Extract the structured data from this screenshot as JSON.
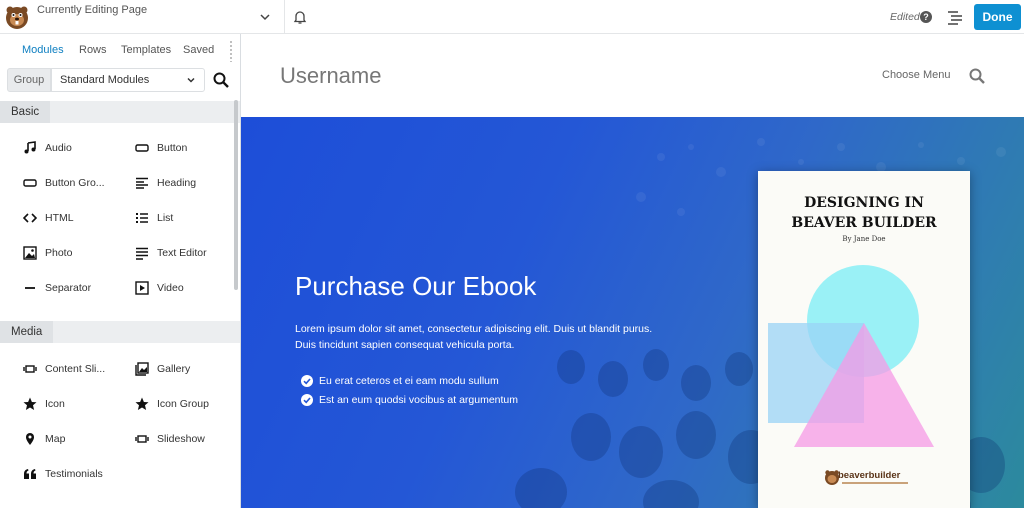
{
  "topbar": {
    "context_label": "Currently Editing Page",
    "status": "Edited",
    "help": "?",
    "done_label": "Done"
  },
  "sidebar": {
    "tabs": [
      "Modules",
      "Rows",
      "Templates",
      "Saved"
    ],
    "active_tab": "Modules",
    "group_button": "Group",
    "group_select_value": "Standard Modules",
    "sections": [
      {
        "label": "Basic",
        "modules": [
          {
            "label": "Audio",
            "icon": "music-note-icon"
          },
          {
            "label": "Button",
            "icon": "button-icon"
          },
          {
            "label": "Button Gro...",
            "icon": "button-group-icon"
          },
          {
            "label": "Heading",
            "icon": "heading-icon"
          },
          {
            "label": "HTML",
            "icon": "code-icon"
          },
          {
            "label": "List",
            "icon": "list-icon"
          },
          {
            "label": "Photo",
            "icon": "photo-icon"
          },
          {
            "label": "Text Editor",
            "icon": "text-editor-icon"
          },
          {
            "label": "Separator",
            "icon": "separator-icon"
          },
          {
            "label": "Video",
            "icon": "video-icon"
          }
        ]
      },
      {
        "label": "Media",
        "modules": [
          {
            "label": "Content Sli...",
            "icon": "content-slider-icon"
          },
          {
            "label": "Gallery",
            "icon": "gallery-icon"
          },
          {
            "label": "Icon",
            "icon": "star-icon"
          },
          {
            "label": "Icon Group",
            "icon": "star-icon"
          },
          {
            "label": "Map",
            "icon": "map-pin-icon"
          },
          {
            "label": "Slideshow",
            "icon": "slideshow-icon"
          },
          {
            "label": "Testimonials",
            "icon": "quote-icon"
          }
        ]
      }
    ]
  },
  "page": {
    "site_title": "Username",
    "menu_label": "Choose Menu",
    "hero": {
      "heading": "Purchase Our Ebook",
      "paragraph": "Lorem ipsum dolor sit amet, consectetur adipiscing elit. Duis ut blandit purus. Duis tincidunt sapien consequat vehicula porta.",
      "checklist": [
        "Eu erat ceteros et ei eam modu sullum",
        "Est an eum quodsi vocibus at argumentum"
      ]
    },
    "book": {
      "title_line1": "DESIGNING IN",
      "title_line2": "BEAVER BUILDER",
      "author": "By Jane Doe",
      "brand": "beaverbuilder"
    }
  },
  "colors": {
    "accent": "#0e90d2",
    "tab_active": "#0e7fc1",
    "hero_start": "#1d4ed8",
    "hero_end": "#2c8a9d"
  }
}
